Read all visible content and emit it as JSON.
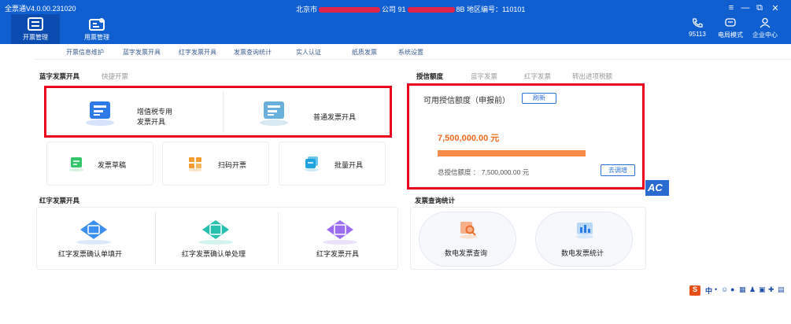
{
  "app": {
    "version": "全票通V4.0.00.231020",
    "company_prefix": "北京市",
    "company_mid": "公司 91",
    "company_suffix": "8B 地区编号：110101"
  },
  "nav": {
    "issue": "开票管理",
    "use": "用票管理"
  },
  "header_right": {
    "phone": "95113",
    "mode": "电局模式",
    "enterprise": "企业中心"
  },
  "subnav": [
    "开票信息维护",
    "蓝字发票开具",
    "红字发票开具",
    "发票查询统计",
    "实人认证",
    "纸质发票",
    "系统设置"
  ],
  "blue": {
    "title": "蓝字发票开具",
    "quick": "快捷开票",
    "vat_line1": "增值税专用",
    "vat_line2": "发票开具",
    "normal": "普通发票开具",
    "draft": "发票草稿",
    "scan": "扫码开票",
    "batch": "批量开具"
  },
  "credit": {
    "tabs": [
      "授信额度",
      "蓝字发票",
      "红字发票",
      "转出进项税额"
    ],
    "title": "可用授信额度（申报前）",
    "refresh": "刷新",
    "amount": "7,500,000.00 元",
    "total": "总授信额度 ： 7,500,000.00 元",
    "detail": "去调增",
    "used_fraction": 1.0
  },
  "red": {
    "title": "红字发票开具",
    "fill": "红字发票确认单填开",
    "handle": "红字发票确认单处理",
    "issue": "红字发票开具"
  },
  "query": {
    "title": "发票查询统计",
    "search": "数电发票查询",
    "stats": "数电发票统计"
  },
  "logo_text": "AC",
  "tray": {
    "ime": "S",
    "lang": "中"
  }
}
